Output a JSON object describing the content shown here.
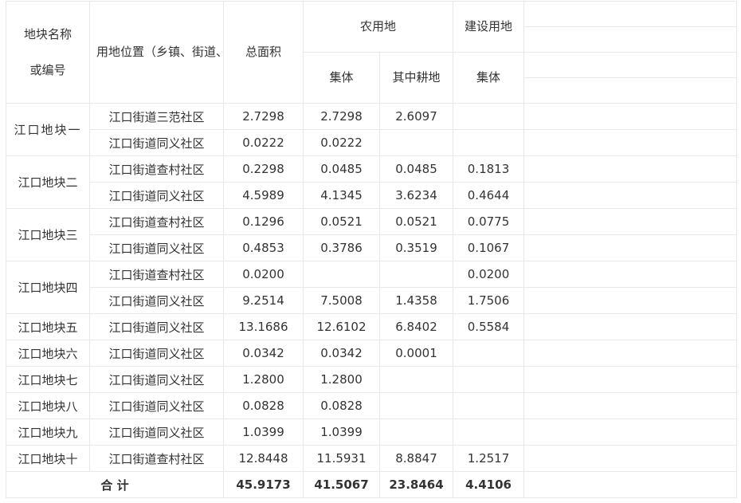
{
  "header": {
    "name_line1": "地块名称",
    "name_line2": "或编号",
    "location": "用地位置（乡镇、街道、村、社居）",
    "total_area": "总面积",
    "agri_land": "农用地",
    "construction_land": "建设用地",
    "collective_agri": "集体",
    "cultivated": "其中耕地",
    "collective_construction": "集体"
  },
  "plots": [
    {
      "name": "江口地块一",
      "rows": [
        {
          "location": "江口街道三范社区",
          "total": "2.7298",
          "collective": "2.7298",
          "cultivated": "2.6097",
          "construction": ""
        },
        {
          "location": "江口街道同义社区",
          "total": "0.0222",
          "collective": "0.0222",
          "cultivated": "",
          "construction": ""
        }
      ]
    },
    {
      "name": "江口地块二",
      "rows": [
        {
          "location": "江口街道查村社区",
          "total": "0.2298",
          "collective": "0.0485",
          "cultivated": "0.0485",
          "construction": "0.1813"
        },
        {
          "location": "江口街道同义社区",
          "total": "4.5989",
          "collective": "4.1345",
          "cultivated": "3.6234",
          "construction": "0.4644"
        }
      ]
    },
    {
      "name": "江口地块三",
      "rows": [
        {
          "location": "江口街道查村社区",
          "total": "0.1296",
          "collective": "0.0521",
          "cultivated": "0.0521",
          "construction": "0.0775"
        },
        {
          "location": "江口街道同义社区",
          "total": "0.4853",
          "collective": "0.3786",
          "cultivated": "0.3519",
          "construction": "0.1067"
        }
      ]
    },
    {
      "name": "江口地块四",
      "rows": [
        {
          "location": "江口街道查村社区",
          "total": "0.0200",
          "collective": "",
          "cultivated": "",
          "construction": "0.0200"
        },
        {
          "location": "江口街道同义社区",
          "total": "9.2514",
          "collective": "7.5008",
          "cultivated": "1.4358",
          "construction": "1.7506"
        }
      ]
    },
    {
      "name": "江口地块五",
      "rows": [
        {
          "location": "江口街道同义社区",
          "total": "13.1686",
          "collective": "12.6102",
          "cultivated": "6.8402",
          "construction": "0.5584"
        }
      ]
    },
    {
      "name": "江口地块六",
      "rows": [
        {
          "location": "江口街道同义社区",
          "total": "0.0342",
          "collective": "0.0342",
          "cultivated": "0.0001",
          "construction": ""
        }
      ]
    },
    {
      "name": "江口地块七",
      "rows": [
        {
          "location": "江口街道同义社区",
          "total": "1.2800",
          "collective": "1.2800",
          "cultivated": "",
          "construction": ""
        }
      ]
    },
    {
      "name": "江口地块八",
      "rows": [
        {
          "location": "江口街道同义社区",
          "total": "0.0828",
          "collective": "0.0828",
          "cultivated": "",
          "construction": ""
        }
      ]
    },
    {
      "name": "江口地块九",
      "rows": [
        {
          "location": "江口街道同义社区",
          "total": "1.0399",
          "collective": "1.0399",
          "cultivated": "",
          "construction": ""
        }
      ]
    },
    {
      "name": "江口地块十",
      "rows": [
        {
          "location": "江口街道查村社区",
          "total": "12.8448",
          "collective": "11.5931",
          "cultivated": "8.8847",
          "construction": "1.2517"
        }
      ]
    }
  ],
  "totals": {
    "label": "合 计",
    "total": "45.9173",
    "collective": "41.5067",
    "cultivated": "23.8464",
    "construction": "4.4106"
  }
}
